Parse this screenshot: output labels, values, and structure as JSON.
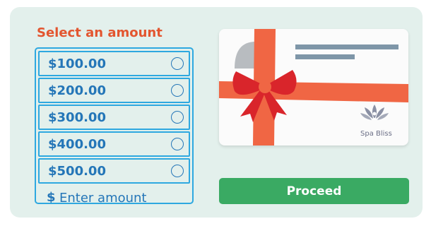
{
  "heading": "Select an amount",
  "amounts": [
    {
      "label": "$100.00"
    },
    {
      "label": "$200.00"
    },
    {
      "label": "$300.00"
    },
    {
      "label": "$400.00"
    },
    {
      "label": "$500.00"
    }
  ],
  "custom_amount": {
    "currency_symbol": "$",
    "placeholder": "Enter amount",
    "value": ""
  },
  "gift_card": {
    "brand_name": "Spa Bliss",
    "logo_icon": "lotus-meditation-icon"
  },
  "proceed_label": "Proceed",
  "colors": {
    "panel_background": "#e3f0ec",
    "heading": "#e3552f",
    "option_border": "#2ea8e0",
    "option_text": "#2476b8",
    "ribbon": "#f06644",
    "bow": "#d9252b",
    "button": "#3aaa63"
  }
}
